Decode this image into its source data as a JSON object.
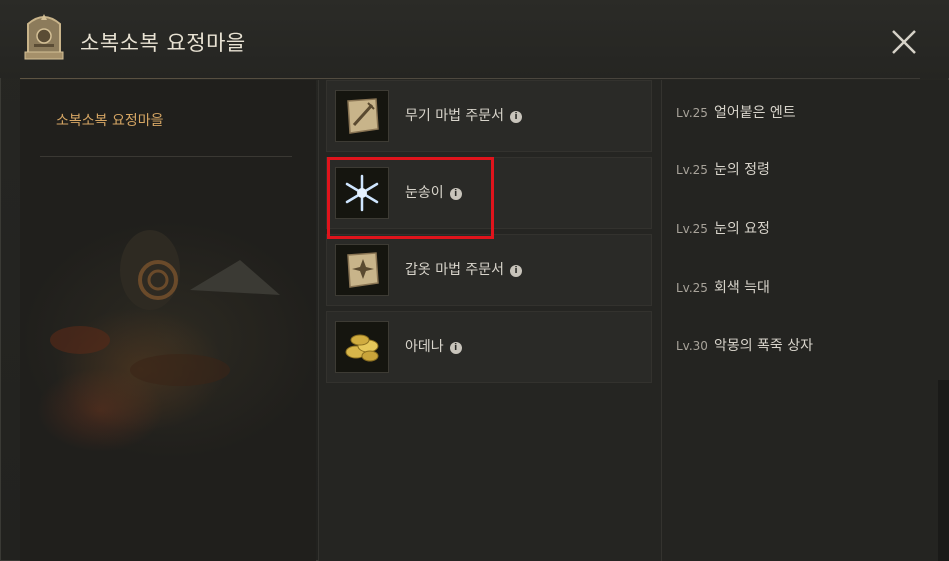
{
  "window": {
    "title": "소복소복 요정마을",
    "close_icon": "close-x-icon"
  },
  "left": {
    "item_label": "소복소복 요정마을"
  },
  "rewards": [
    {
      "label": "무기 마법 주문서",
      "icon": "weapon-scroll-icon",
      "info": "i"
    },
    {
      "label": "눈송이",
      "icon": "snowflake-icon",
      "info": "i"
    },
    {
      "label": "갑옷 마법 주문서",
      "icon": "armor-scroll-icon",
      "info": "i"
    },
    {
      "label": "아데나",
      "icon": "adena-coins-icon",
      "info": "i"
    }
  ],
  "monsters": [
    {
      "level": "Lv.25",
      "name": "얼어붙은 엔트"
    },
    {
      "level": "Lv.25",
      "name": "눈의 정령"
    },
    {
      "level": "Lv.25",
      "name": "눈의 요정"
    },
    {
      "level": "Lv.25",
      "name": "회색 늑대"
    },
    {
      "level": "Lv.30",
      "name": "악몽의 폭죽 상자"
    }
  ],
  "colors": {
    "accent_gold": "#d6a664",
    "highlight_red": "#e0141c"
  }
}
